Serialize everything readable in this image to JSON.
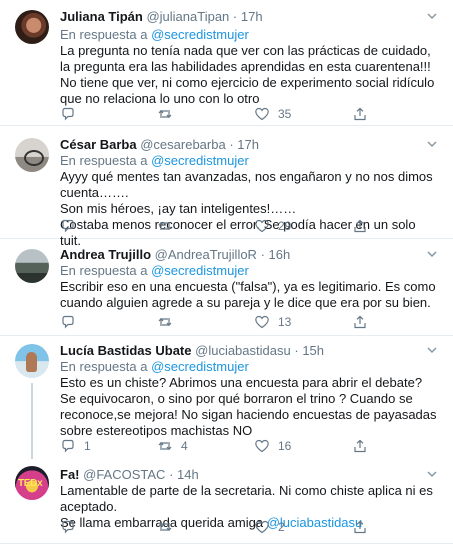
{
  "tweets": [
    {
      "name": "Juliana Tipán",
      "handle": "@julianaTipan",
      "dot": "·",
      "time": "17h",
      "reply_prefix": "En respuesta a",
      "reply_to": "@secredistmujer",
      "lines": [
        "La pregunta no tenía nada que ver con las prácticas de cuidado, la pregunta era las habilidades aprendidas en esta cuarentena!!!",
        "No tiene que ver, ni como ejercicio de experimento social ridículo que no relaciona lo uno con lo otro"
      ],
      "replies": "",
      "retweets": "",
      "likes": "35"
    },
    {
      "name": "César Barba",
      "handle": "@cesarebarba",
      "dot": "·",
      "time": "17h",
      "reply_prefix": "En respuesta a",
      "reply_to": "@secredistmujer",
      "lines": [
        "Ayyy qué mentes tan avanzadas, nos engañaron y no nos dimos cuenta…….",
        "Son mis héroes, ¡ay tan inteligentes!……",
        "Costaba menos reconocer el error. Se podía hacer en un solo tuit."
      ],
      "replies": "",
      "retweets": "",
      "likes": "29"
    },
    {
      "name": "Andrea Trujillo",
      "handle": "@AndreaTrujilloR",
      "dot": "·",
      "time": "16h",
      "reply_prefix": "En respuesta a",
      "reply_to": "@secredistmujer",
      "lines": [
        "Escribir eso en una encuesta (\"falsa\"), ya es legitimario. Es como cuando alguien agrede a su pareja y le dice que era por su bien."
      ],
      "replies": "",
      "retweets": "",
      "likes": "13"
    },
    {
      "name": "Lucía Bastidas Ubate",
      "handle": "@luciabastidasu",
      "dot": "·",
      "time": "15h",
      "reply_prefix": "En respuesta a",
      "reply_to": "@secredistmujer",
      "lines": [
        "Esto es un chiste? Abrimos una encuesta para abrir el debate? Se equivocaron, o sino por qué borraron el trino ? Cuando se reconoce,se mejora! No sigan haciendo encuestas de payasadas sobre estereotipos machistas NO"
      ],
      "replies": "1",
      "retweets": "4",
      "likes": "16"
    },
    {
      "name": "Fa!",
      "handle": "@FACOSTAC",
      "dot": "·",
      "time": "14h",
      "reply_prefix": "",
      "reply_to": "",
      "lines": [
        "Lamentable de parte de la secretaria. Ni como chiste aplica ni es aceptado.",
        "Se llama embarrada querida amiga"
      ],
      "mention_after": "@luciabastidasu",
      "avatar_text": "TEDx",
      "replies": "",
      "retweets": "",
      "likes": "2"
    }
  ],
  "icons": {
    "reply": "reply-icon",
    "retweet": "retweet-icon",
    "like": "heart-icon",
    "share": "share-icon",
    "menu": "chevron-down-icon"
  },
  "colors": {
    "link": "#1b95e0",
    "secondary": "#657786",
    "text": "#14171a"
  }
}
